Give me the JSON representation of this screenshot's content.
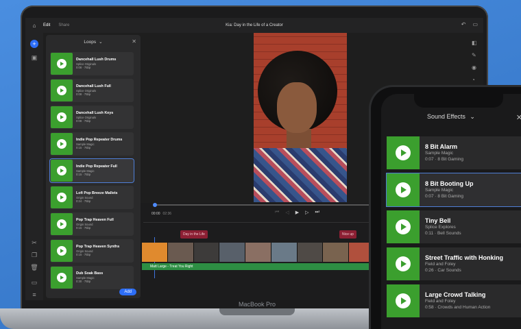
{
  "laptop": {
    "brand": "MacBook Pro",
    "topbar": {
      "tabs": [
        "Edit",
        "Share"
      ],
      "title": "Kia: Day in the Life of a Creator"
    },
    "loops_panel": {
      "title": "Loops",
      "items": [
        {
          "name": "Dancehall Lush Drums",
          "source": "Splice Originals",
          "meta": "0:08 · 75bp"
        },
        {
          "name": "Dancehall Lush Full",
          "source": "Splice Originals",
          "meta": "0:08 · 75bp"
        },
        {
          "name": "Dancehall Lush Keys",
          "source": "Splice Originals",
          "meta": "0:08 · 75bp"
        },
        {
          "name": "Indie Pop Repeater Drums",
          "source": "Sample Magic",
          "meta": "0:15 · 75bp"
        },
        {
          "name": "Indie Pop Repeater Full",
          "source": "Sample Magic",
          "meta": "0:15 · 75bp"
        },
        {
          "name": "Lofi Pop Breeze Mallets",
          "source": "Origin Sound",
          "meta": "0:24 · 75bp"
        },
        {
          "name": "Pop Trap Heaven Full",
          "source": "Origin Sound",
          "meta": "0:15 · 75bp"
        },
        {
          "name": "Pop Trap Heaven Synths",
          "source": "Origin Sound",
          "meta": "0:15 · 75bp"
        },
        {
          "name": "Dub Soak Bass",
          "source": "Sample Magic",
          "meta": "0:30 · 75bp"
        }
      ],
      "add_label": "Add"
    },
    "timeline": {
      "current_time": "00:00",
      "duration": "02:36",
      "tags": [
        "Day in the Life",
        "Nice up"
      ],
      "audio_track": "Matt Large - Treat You Right"
    }
  },
  "phone": {
    "title": "Sound Effects",
    "items": [
      {
        "name": "8 Bit Alarm",
        "source": "Sample Magic",
        "meta": "0:07 · 8 Bit Gaming"
      },
      {
        "name": "8 Bit Booting Up",
        "source": "Sample Magic",
        "meta": "0:07 · 8 Bit Gaming"
      },
      {
        "name": "Tiny Bell",
        "source": "Splice Explores",
        "meta": "0:11 · Bell Sounds"
      },
      {
        "name": "Street Traffic with Honking",
        "source": "Field and Foley",
        "meta": "0:26 · Car Sounds"
      },
      {
        "name": "Large Crowd Talking",
        "source": "Field and Foley",
        "meta": "0:58 · Crowds and Human Action"
      }
    ]
  },
  "colors": {
    "accent": "#2d6ef7",
    "thumb_green": "#3b9f2e",
    "selected_outline": "#4f7fd8"
  }
}
